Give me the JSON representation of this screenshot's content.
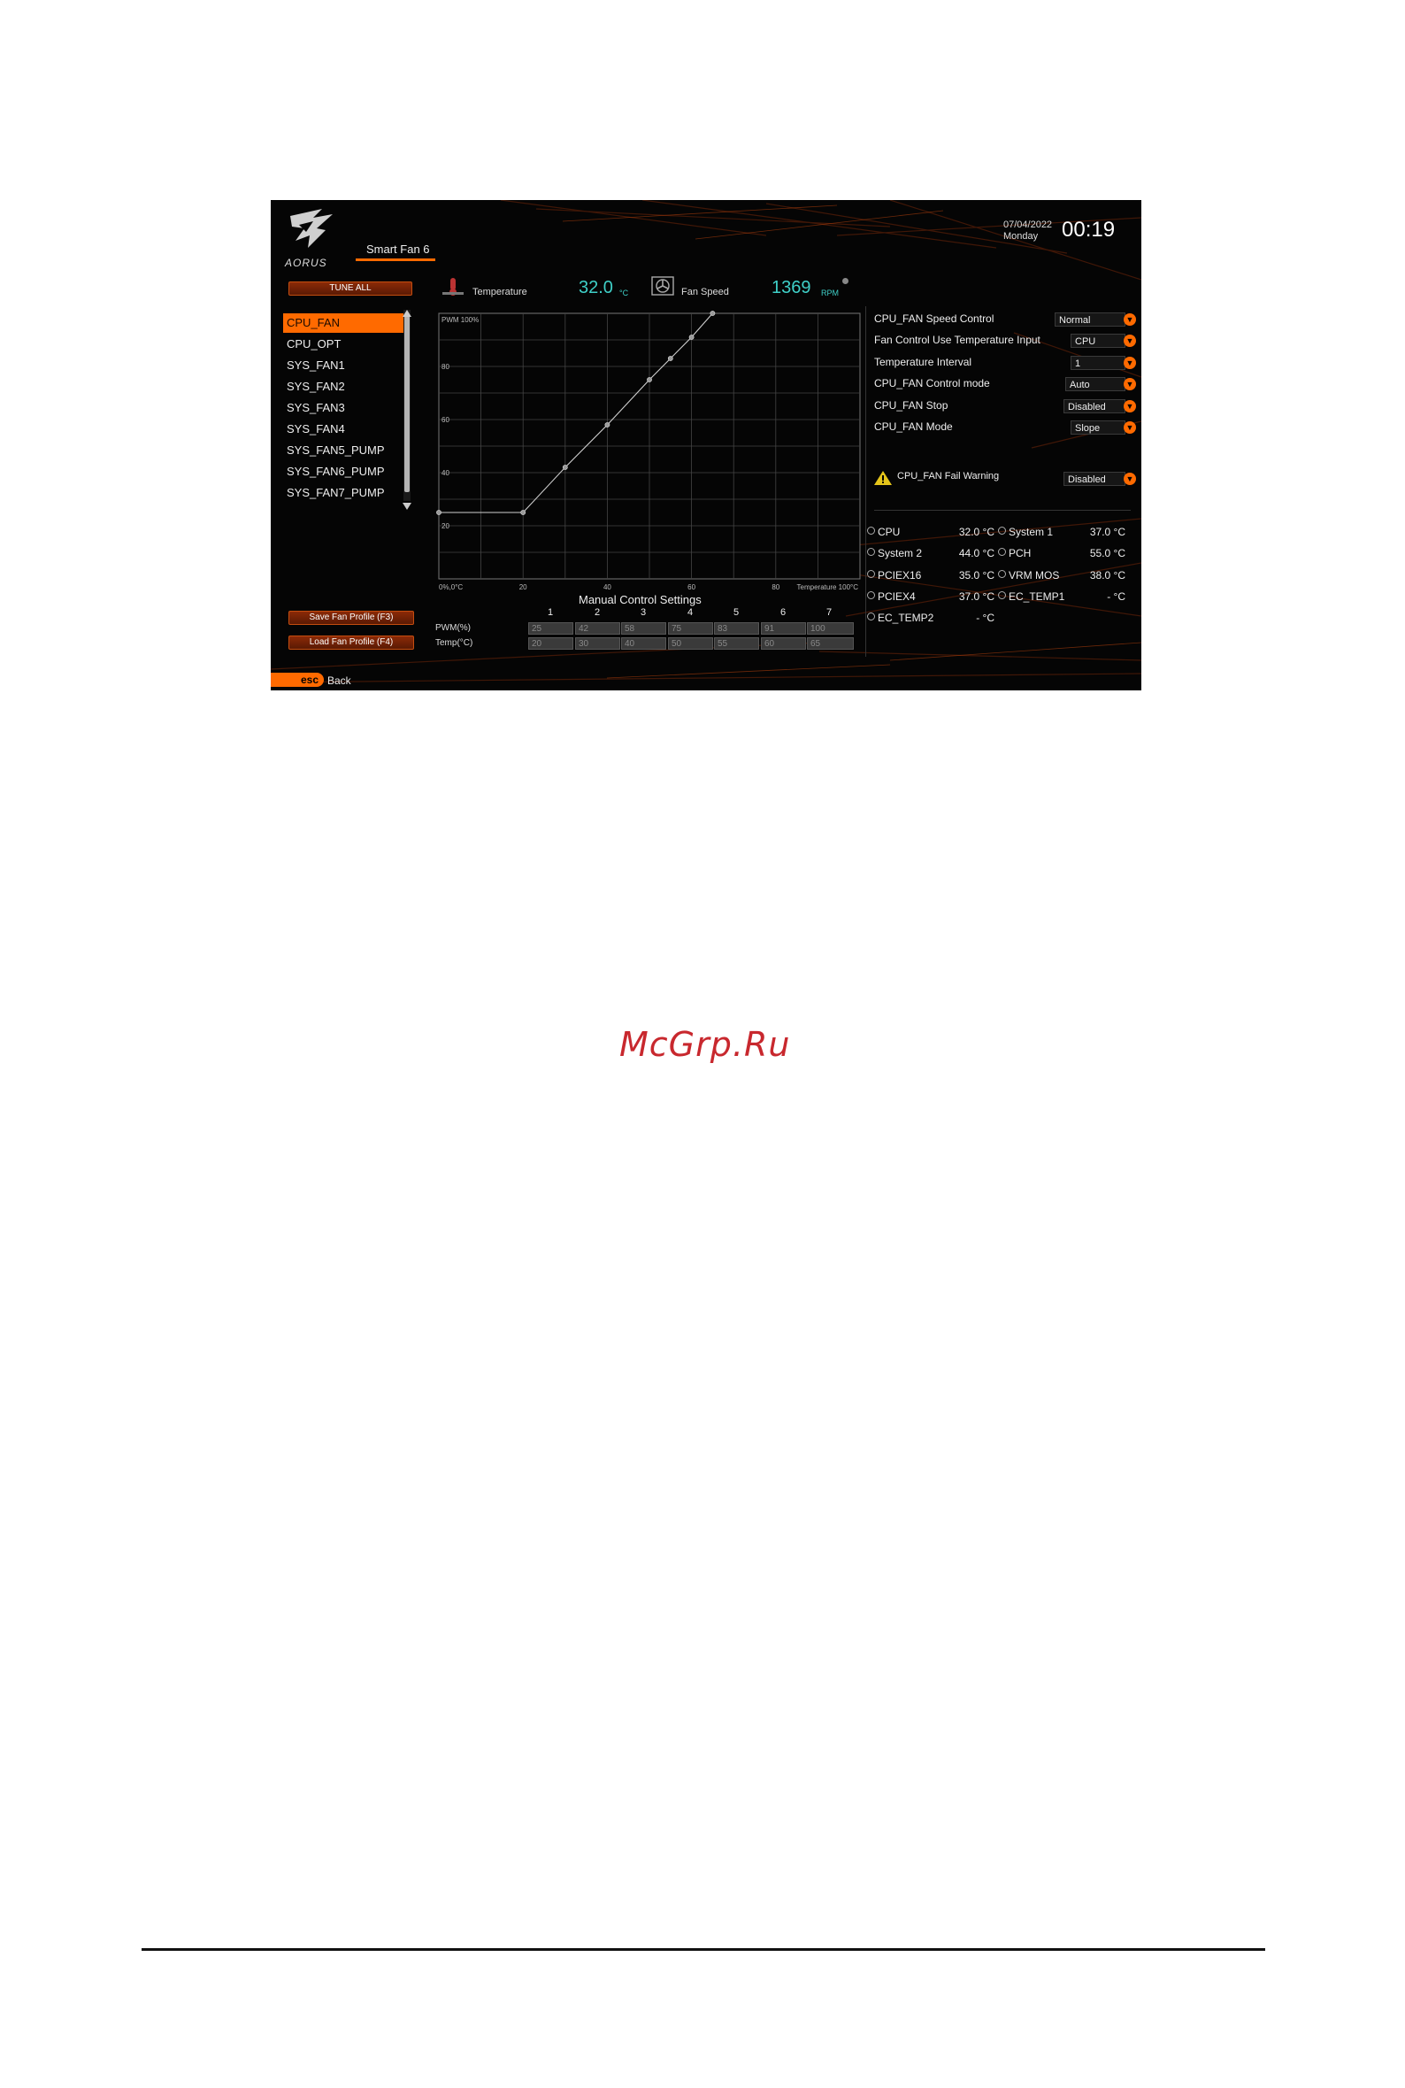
{
  "header": {
    "brand": "AORUS",
    "tab_title": "Smart Fan 6",
    "date": "07/04/2022",
    "day": "Monday",
    "time": "00:19"
  },
  "left": {
    "tune_all": "TUNE ALL",
    "fans": [
      "CPU_FAN",
      "CPU_OPT",
      "SYS_FAN1",
      "SYS_FAN2",
      "SYS_FAN3",
      "SYS_FAN4",
      "SYS_FAN5_PUMP",
      "SYS_FAN6_PUMP",
      "SYS_FAN7_PUMP"
    ],
    "active_fan": "CPU_FAN",
    "save_profile": "Save Fan Profile (F3)",
    "load_profile": "Load Fan Profile (F4)"
  },
  "readouts": {
    "temperature_label": "Temperature",
    "temperature_value": "32.0",
    "temperature_unit": "°C",
    "fan_speed_label": "Fan Speed",
    "fan_speed_value": "1369",
    "fan_speed_unit": "RPM"
  },
  "chart_data": {
    "type": "line",
    "x": [
      0,
      20,
      30,
      40,
      50,
      55,
      60,
      65
    ],
    "y": [
      25,
      25,
      42,
      58,
      75,
      83,
      91,
      100
    ],
    "xlim": [
      0,
      100
    ],
    "ylim": [
      0,
      100
    ],
    "x_ticks": [
      "0%,0°C",
      "20",
      "40",
      "60",
      "80",
      "Temperature 100°C"
    ],
    "y_ticks": [
      "20",
      "40",
      "60",
      "80",
      "PWM 100%"
    ],
    "grid": true
  },
  "manual": {
    "title": "Manual Control Settings",
    "columns": [
      "1",
      "2",
      "3",
      "4",
      "5",
      "6",
      "7"
    ],
    "pwm_label": "PWM(%)",
    "temp_label": "Temp(°C)",
    "pwm": [
      "25",
      "42",
      "58",
      "75",
      "83",
      "91",
      "100"
    ],
    "temp": [
      "20",
      "30",
      "40",
      "50",
      "55",
      "60",
      "65"
    ]
  },
  "settings": [
    {
      "label": "CPU_FAN Speed Control",
      "value": "Normal"
    },
    {
      "label": "Fan Control Use Temperature Input",
      "value": "CPU"
    },
    {
      "label": "Temperature Interval",
      "value": "1"
    },
    {
      "label": "CPU_FAN Control mode",
      "value": "Auto"
    },
    {
      "label": "CPU_FAN Stop",
      "value": "Disabled"
    },
    {
      "label": "CPU_FAN Mode",
      "value": "Slope"
    }
  ],
  "warning": {
    "label": "CPU_FAN Fail Warning",
    "value": "Disabled"
  },
  "sensors": [
    {
      "name": "CPU",
      "value": "32.0 °C"
    },
    {
      "name": "System 1",
      "value": "37.0 °C"
    },
    {
      "name": "System 2",
      "value": "44.0 °C"
    },
    {
      "name": "PCH",
      "value": "55.0 °C"
    },
    {
      "name": "PCIEX16",
      "value": "35.0 °C"
    },
    {
      "name": "VRM MOS",
      "value": "38.0 °C"
    },
    {
      "name": "PCIEX4",
      "value": "37.0 °C"
    },
    {
      "name": "EC_TEMP1",
      "value": "- °C"
    },
    {
      "name": "EC_TEMP2",
      "value": "- °C"
    }
  ],
  "footer": {
    "esc": "esc",
    "back": "Back"
  },
  "watermark": "McGrp.Ru",
  "colors": {
    "accent": "#ff6a00",
    "readout": "#3fd0c8",
    "background": "#050505"
  }
}
